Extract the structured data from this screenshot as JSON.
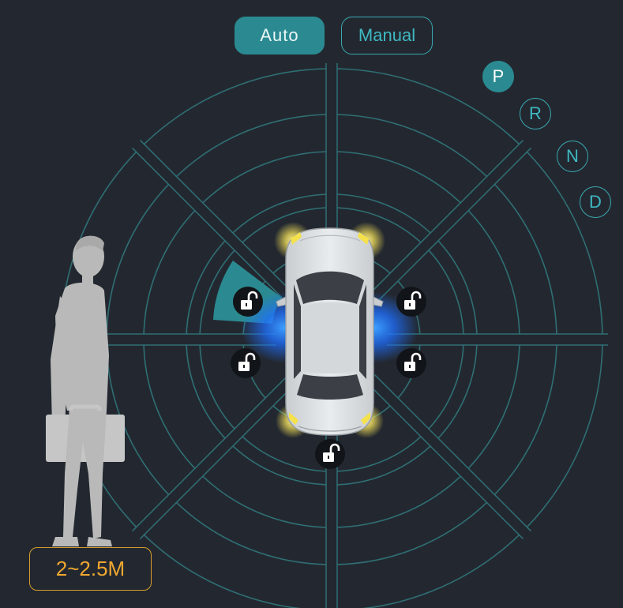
{
  "mode": {
    "auto_label": "Auto",
    "manual_label": "Manual",
    "selected": "Auto"
  },
  "gears": [
    {
      "label": "P",
      "active": true
    },
    {
      "label": "R",
      "active": false
    },
    {
      "label": "N",
      "active": false
    },
    {
      "label": "D",
      "active": false
    }
  ],
  "distance": {
    "label": "2~2.5M"
  },
  "colors": {
    "background": "#232830",
    "accent": "#2b8a91",
    "ring": "#2f6f74",
    "distance": "#f0a830",
    "headlight": "#f2df5a",
    "proximity_glow": "#1f7bff"
  },
  "icons": {
    "lock": "unlocked-padlock-icon",
    "person": "person-with-briefcase-icon",
    "car": "car-top-view-icon"
  }
}
